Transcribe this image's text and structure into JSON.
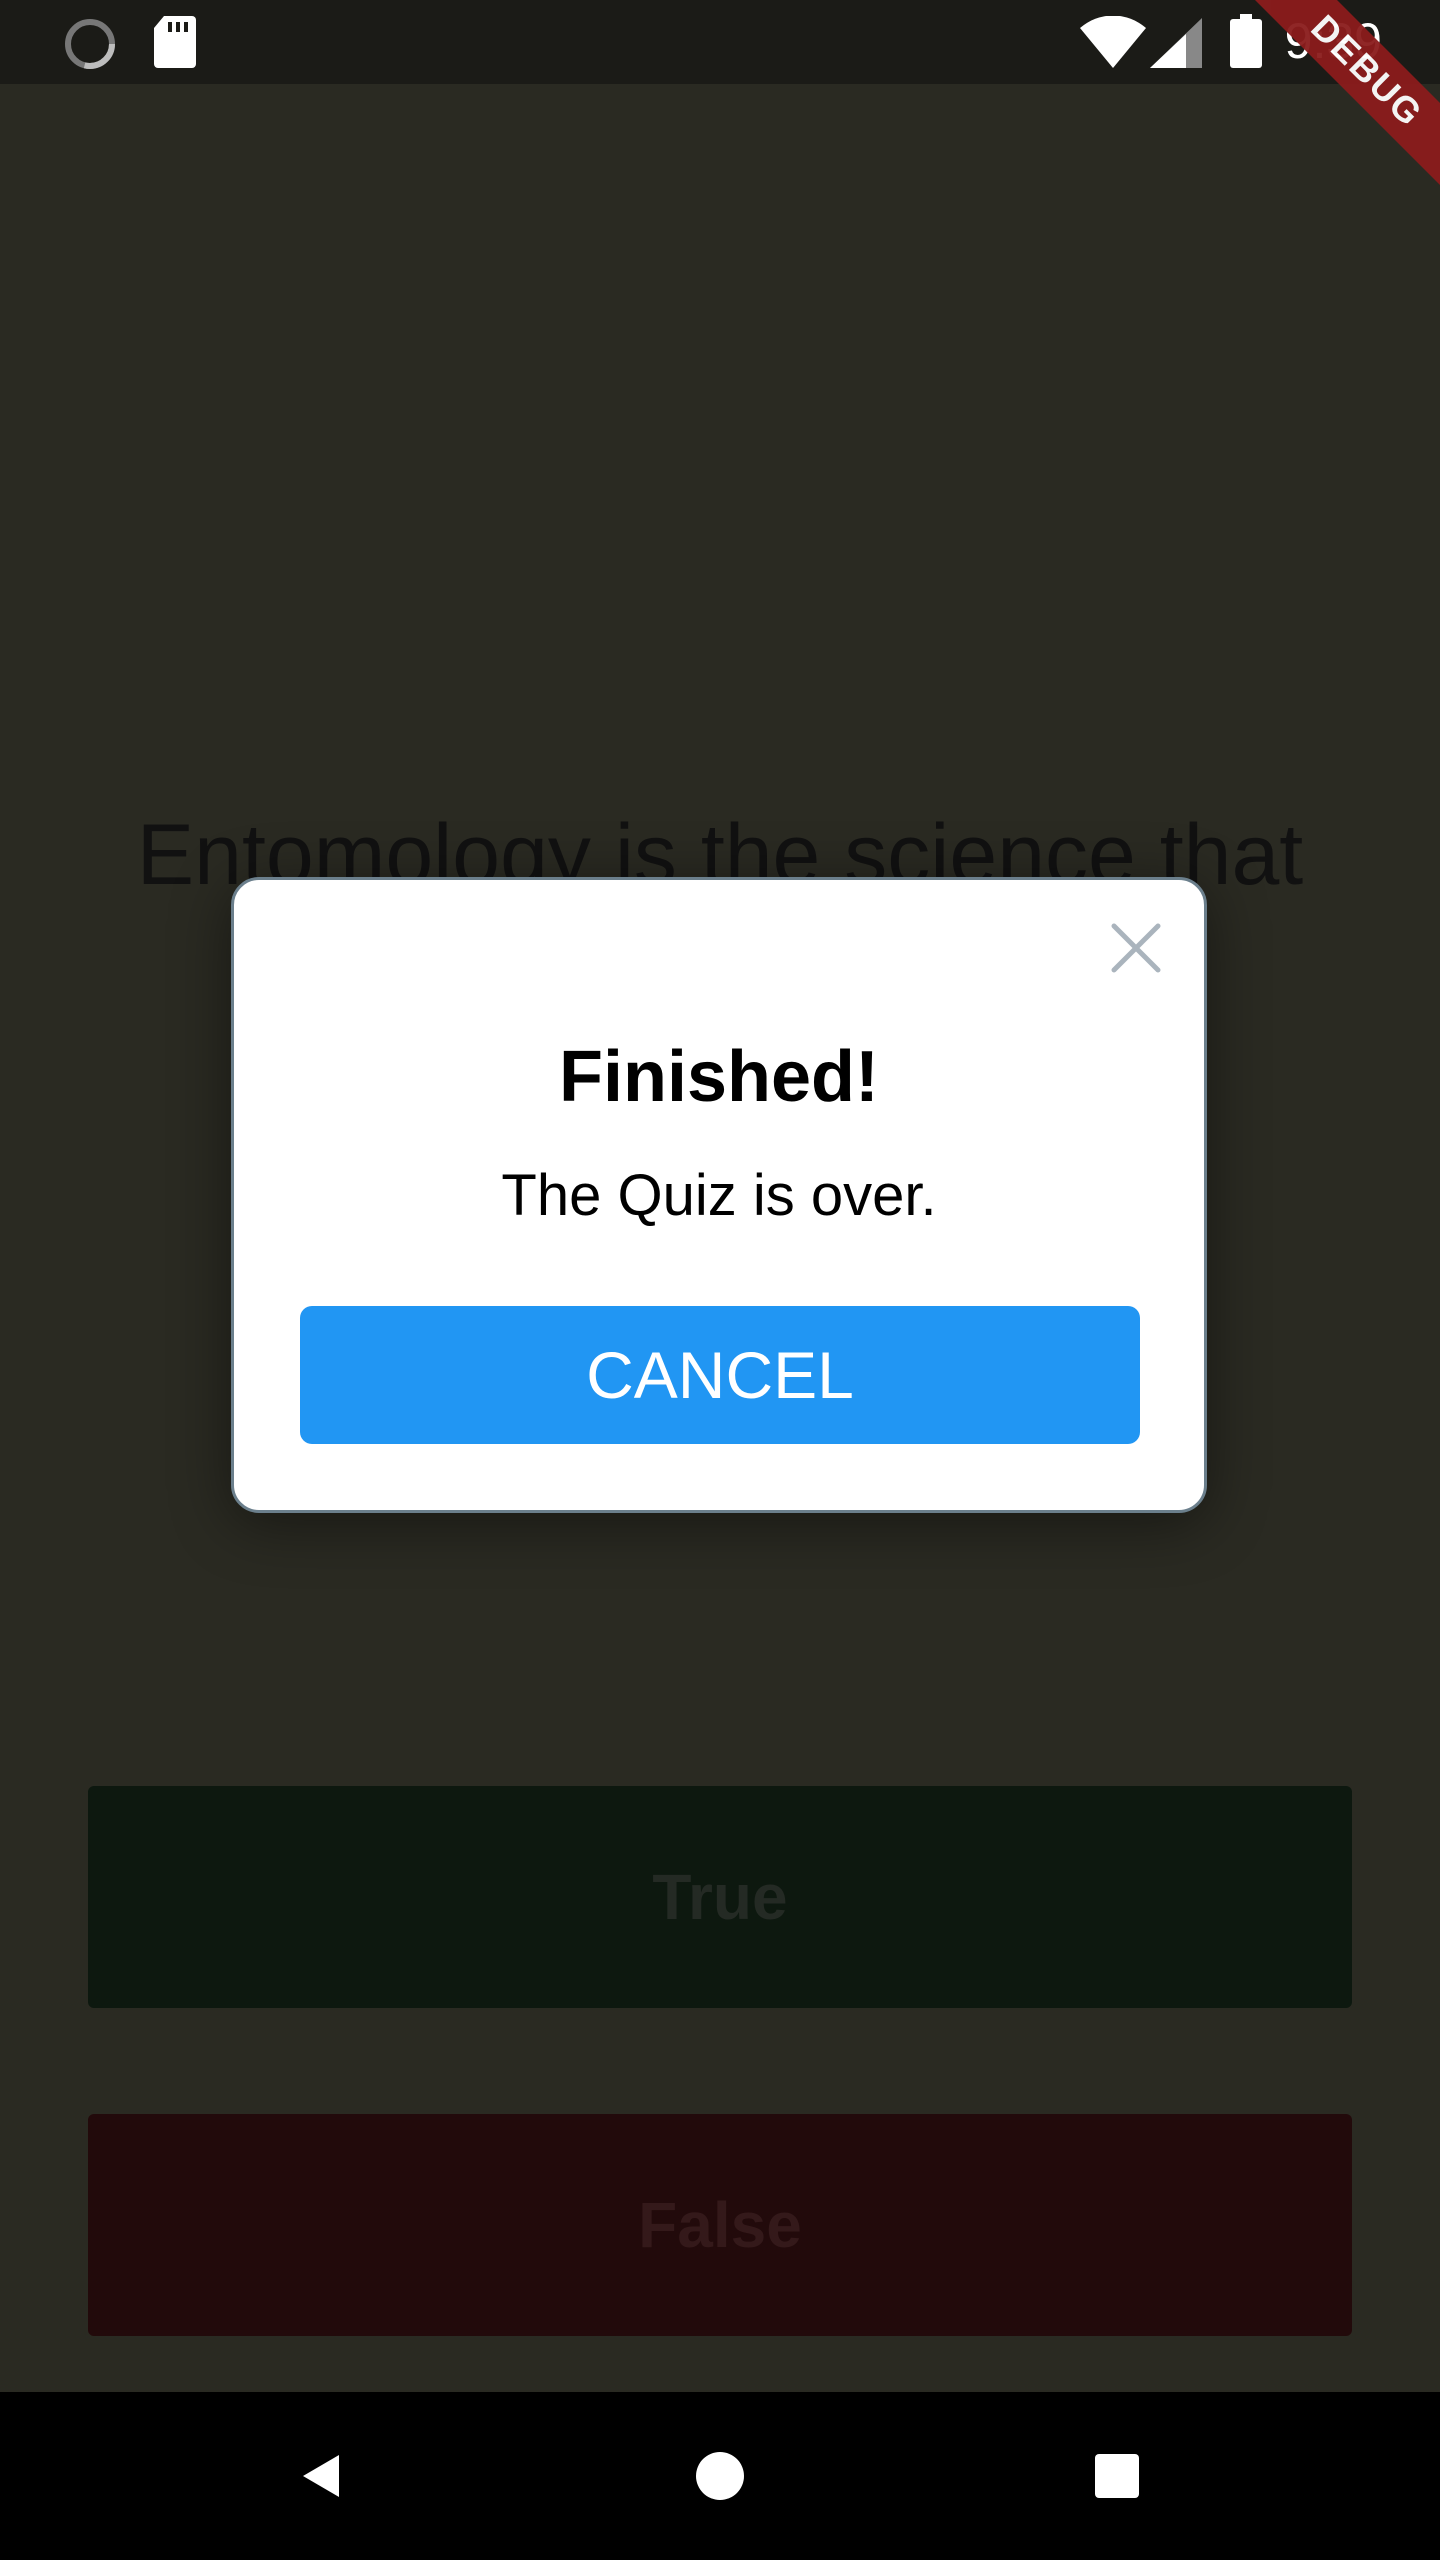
{
  "status_bar": {
    "time": "9:39",
    "icons": [
      "loading-spinner-icon",
      "sd-card-icon",
      "wifi-icon",
      "signal-icon",
      "battery-icon"
    ]
  },
  "debug_banner": {
    "label": "DEBUG"
  },
  "quiz": {
    "question": "Entomology is the science that",
    "true_label": "True",
    "false_label": "False",
    "colors": {
      "true_button": "#0d180f",
      "false_button": "#220a0b"
    }
  },
  "dialog": {
    "title": "Finished!",
    "message": "The Quiz is over.",
    "cancel_label": "CANCEL",
    "close_icon": "close-icon",
    "colors": {
      "cancel_button": "#2196f3",
      "border": "#6b7f8c"
    }
  },
  "nav_bar": {
    "icons": [
      "back-icon",
      "home-icon",
      "recents-icon"
    ]
  }
}
